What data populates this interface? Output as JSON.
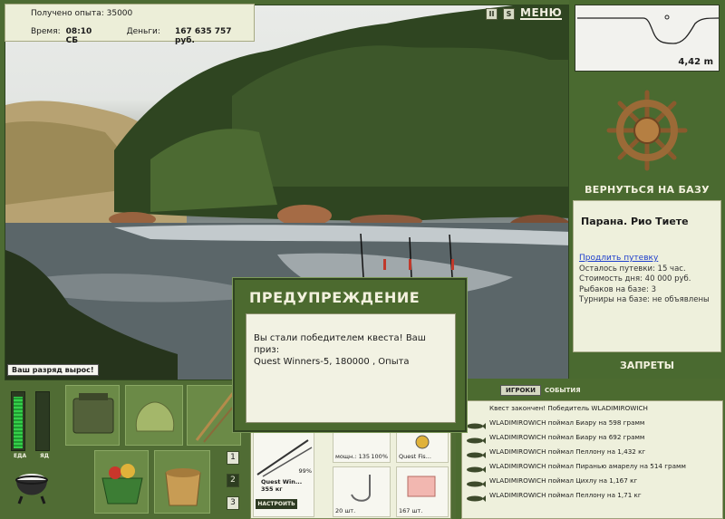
{
  "stats": {
    "exp_label": "Получено опыта:",
    "exp_value": "35000",
    "time_label": "Время:",
    "time_value": "08:10 СБ",
    "money_label": "Деньги:",
    "money_value": "167 635 757 руб."
  },
  "top": {
    "pause_icon": "II",
    "sound_icon": "S",
    "menu_label": "МЕНЮ"
  },
  "rank_banner": "Ваш разряд вырос!",
  "depth": {
    "value": "4,42 m"
  },
  "base_button": "ВЕРНУТЬСЯ НА БАЗУ",
  "location": {
    "title": "Парана. Рио Тиете",
    "extend_link": "Продлить путевку",
    "lines": [
      "Осталось путевки: 15 час.",
      "Стоимость дня: 40 000 руб.",
      "Рыбаков на базе: 3",
      "Турниры на базе: не объявлены"
    ]
  },
  "bans_button": "ЗАПРЕТЫ",
  "meters": {
    "food_label": "ЕДА",
    "food_level": 0.95,
    "poison_label": "ЯД",
    "poison_level": 0.0
  },
  "inventory_pages": [
    "1",
    "2",
    "3"
  ],
  "tackle": {
    "rod_name": "Quest Win...",
    "rod_weight": "355 кг",
    "rod_percent": "99%",
    "reel_label": "мощн.: 135",
    "reel_percent": "100%",
    "line_label": "Quest Fis...",
    "hook_count": "20 шт.",
    "bait_count": "167 шт.",
    "adjust_button": "НАСТРОИТЬ"
  },
  "tabs": {
    "players": "ИГРОКИ",
    "events": "СОБЫТИЯ"
  },
  "events": [
    "Квест закончен! Победитель WLADIMIROWICH",
    "WLADIMIROWICH поймал Биару на 598 грамм",
    "WLADIMIROWICH поймал Биару на 692 грамм",
    "WLADIMIROWICH поймал Пеллону на 1,432 кг",
    "WLADIMIROWICH поймал Пиранью амарелу на 514 грамм",
    "WLADIMIROWICH поймал Цихлу на 1,167 кг",
    "WLADIMIROWICH поймал Пеллону на 1,71 кг"
  ],
  "dialog": {
    "title": "ПРЕДУПРЕЖДЕНИЕ",
    "message_line1": "Вы стали победителем квеста! Ваш приз:",
    "message_line2": "Quest Winners-5, 180000 , Опыта"
  },
  "colors": {
    "panel_green": "#4a6a30",
    "panel_light": "#eef0dc",
    "link_blue": "#1e3ecc"
  }
}
